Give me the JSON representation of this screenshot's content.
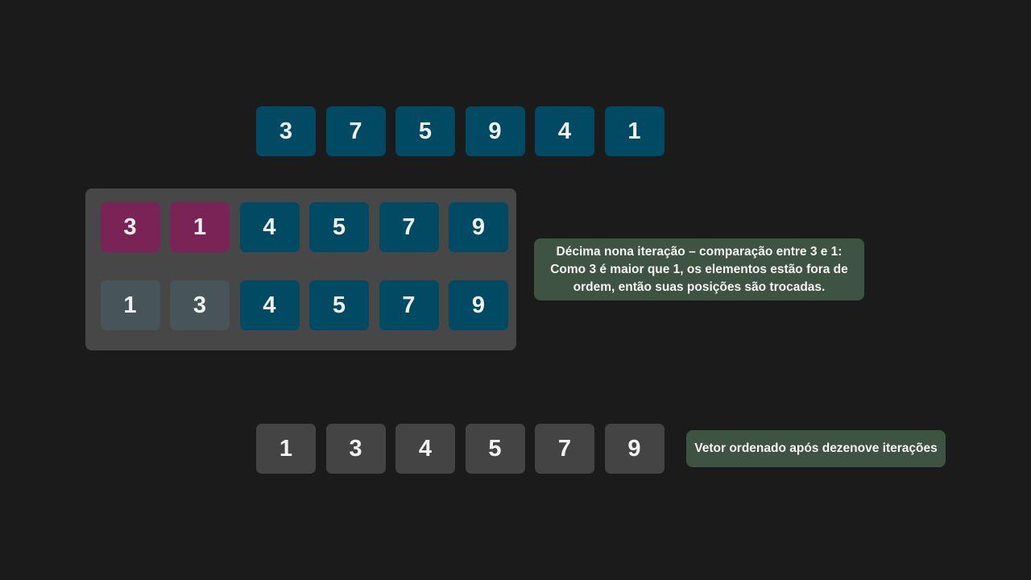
{
  "initial_vector": [
    "3",
    "7",
    "5",
    "9",
    "4",
    "1"
  ],
  "iteration": {
    "comparison_row": [
      "3",
      "1",
      "4",
      "5",
      "7",
      "9"
    ],
    "result_row": [
      "1",
      "3",
      "4",
      "5",
      "7",
      "9"
    ],
    "explanation": "Décima nona iteração – comparação entre 3 e 1: Como 3 é maior que 1, os elementos estão fora de ordem, então suas posições são trocadas."
  },
  "final_vector": [
    "1",
    "3",
    "4",
    "5",
    "7",
    "9"
  ],
  "final_note": "Vetor ordenado após dezenove iterações",
  "colors": {
    "background": "#1b1b1b",
    "unsorted_cell": "#004b63",
    "compared_cell": "#7a2356",
    "swapped_cell": "#475559",
    "sorted_cell": "#444444",
    "panel": "#474747",
    "note": "#3e5341"
  }
}
